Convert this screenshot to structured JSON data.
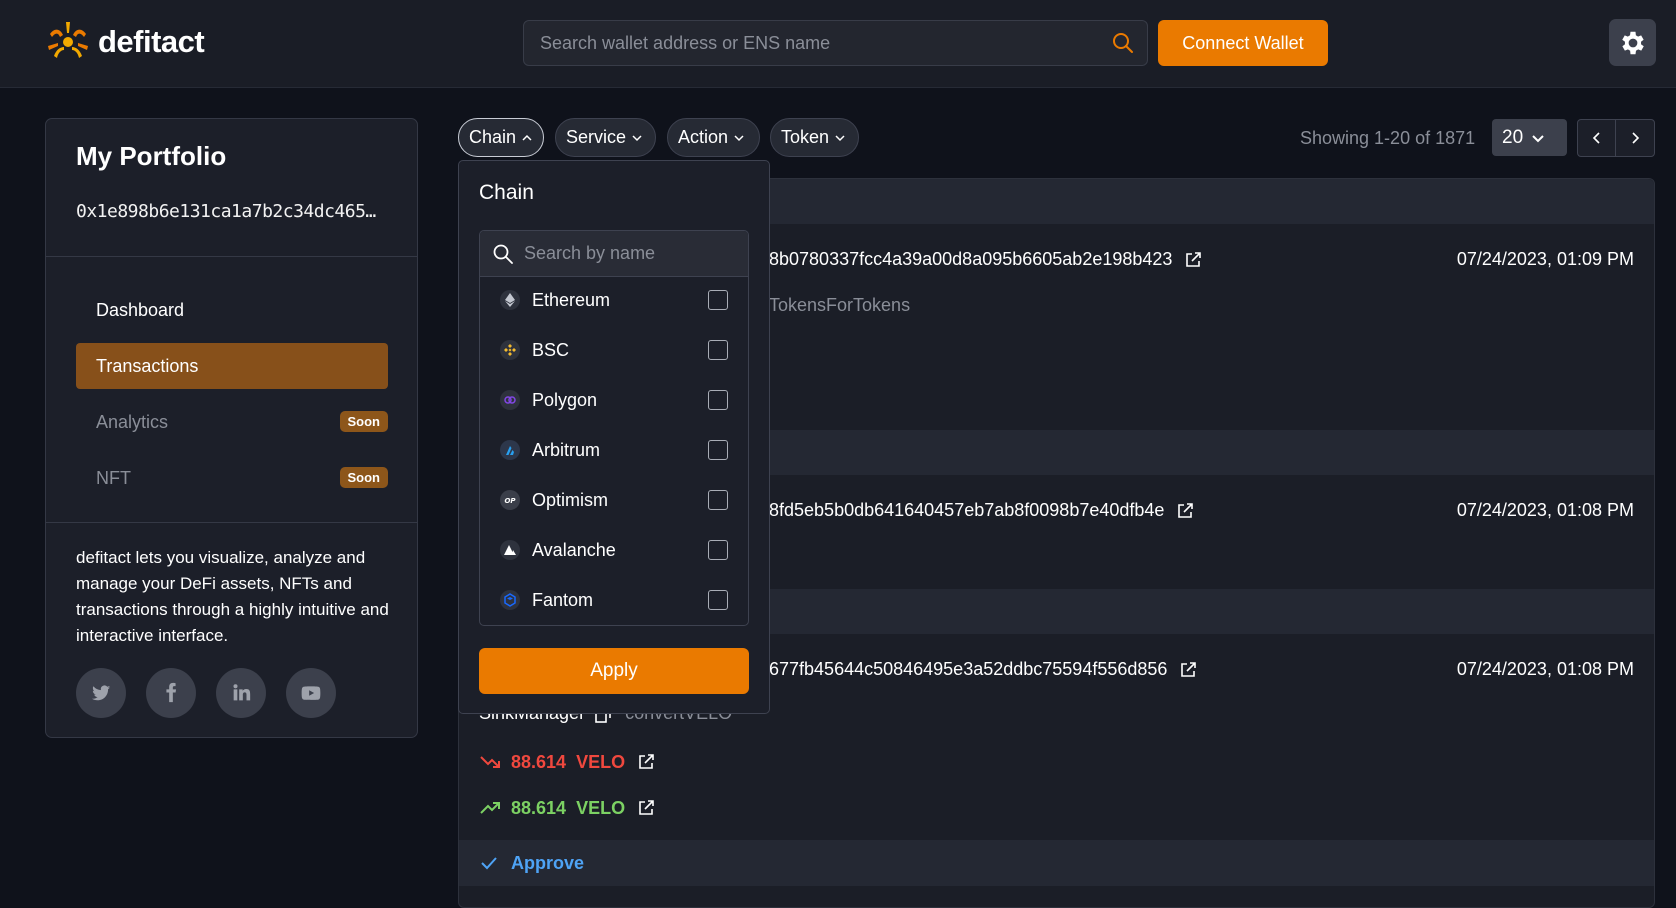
{
  "header": {
    "logo_text": "defitact",
    "search_placeholder": "Search wallet address or ENS name",
    "connect_label": "Connect Wallet"
  },
  "sidebar": {
    "title": "My Portfolio",
    "address": "0x1e898b6e131ca1a7b2c34dc465…",
    "nav": [
      {
        "label": "Dashboard"
      },
      {
        "label": "Transactions"
      },
      {
        "label": "Analytics",
        "badge": "Soon"
      },
      {
        "label": "NFT",
        "badge": "Soon"
      }
    ],
    "description": "defitact lets you visualize, analyze and manage your DeFi assets, NFTs and transactions through a highly intuitive and interactive interface."
  },
  "filters": {
    "chain": "Chain",
    "service": "Service",
    "action": "Action",
    "token": "Token"
  },
  "pagination": {
    "showing": "Showing 1-20 of 1871",
    "per_page": "20"
  },
  "transactions": [
    {
      "hash": "8b0780337fcc4a39a00d8a095b6605ab2e198b423",
      "date": "07/24/2023, 01:09 PM",
      "method": "TokensForTokens"
    },
    {
      "hash": "8fd5eb5b0db641640457eb7ab8f0098b7e40dfb4e",
      "date": "07/24/2023, 01:08 PM"
    },
    {
      "hash": "677fb45644c50846495e3a52ddbc75594f556d856",
      "date": "07/24/2023, 01:08 PM",
      "manager": "SinkManager",
      "function": "convertVELO"
    }
  ],
  "transfers": [
    {
      "amount": "88.614",
      "symbol": "VELO",
      "direction": "out"
    },
    {
      "amount": "88.614",
      "symbol": "VELO",
      "direction": "in"
    }
  ],
  "approve_label": "Approve",
  "dropdown": {
    "title": "Chain",
    "search_placeholder": "Search by name",
    "chains": [
      {
        "name": "Ethereum",
        "icon": "ethereum-icon"
      },
      {
        "name": "BSC",
        "icon": "bsc-icon"
      },
      {
        "name": "Polygon",
        "icon": "polygon-icon"
      },
      {
        "name": "Arbitrum",
        "icon": "arbitrum-icon"
      },
      {
        "name": "Optimism",
        "icon": "optimism-icon"
      },
      {
        "name": "Avalanche",
        "icon": "avalanche-icon"
      },
      {
        "name": "Fantom",
        "icon": "fantom-icon"
      }
    ],
    "apply_label": "Apply"
  },
  "colors": {
    "accent": "#ea7a00",
    "active_nav": "#87501a",
    "negative": "#f0483e",
    "positive": "#7cd163",
    "link_blue": "#4ea3f5"
  }
}
